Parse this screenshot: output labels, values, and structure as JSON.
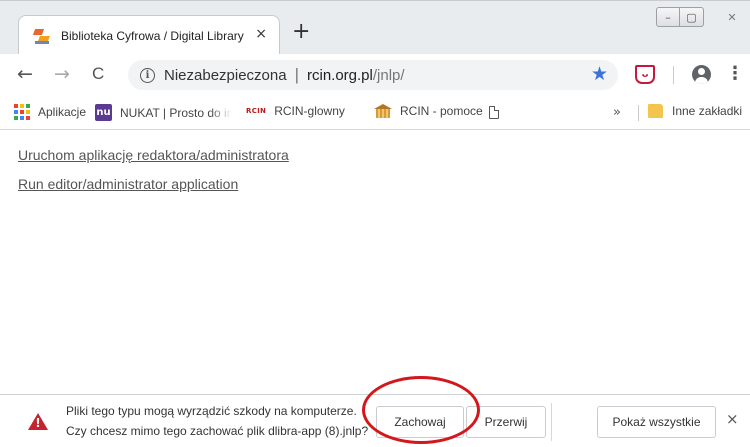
{
  "tab": {
    "title": "Biblioteka Cyfrowa / Digital Library",
    "close": "×"
  },
  "new_tab": "+",
  "window_controls": {
    "minimize": "–",
    "maximize": "▢",
    "close": "✕"
  },
  "toolbar": {
    "back": "←",
    "forward": "→",
    "reload": "C",
    "security_label": "Niezabezpieczona",
    "separator": "|",
    "url_host": "rcin.org.pl",
    "url_path": "/jnlp/",
    "bookmark_star": "★",
    "menu": "⋮"
  },
  "bookmarks": {
    "items": [
      {
        "label": "Aplikacje",
        "icon": "apps-grid-icon"
      },
      {
        "label": "NUKAT | Prosto do info",
        "icon": "nukat-icon"
      },
      {
        "label": "RCIN-glowny",
        "icon": "rcin-icon"
      },
      {
        "label": "RCIN - pomoce",
        "icon": "building-icon"
      },
      {
        "label": "",
        "icon": "page-icon"
      }
    ],
    "overflow": "»",
    "other_bookmarks": "Inne zakładki",
    "nu_logo_text": "nu",
    "rcin_logo_text": "RCIN"
  },
  "content": {
    "links": [
      "Uruchom aplikację redaktora/administratora",
      "Run editor/administrator application"
    ]
  },
  "download_bar": {
    "warning_line1": "Pliki tego typu mogą wyrządzić szkody na komputerze.",
    "warning_line2": "Czy chcesz mimo tego zachować plik dlibra-app (8).jnlp?",
    "keep_label": "Zachowaj",
    "discard_label": "Przerwij",
    "show_all_label": "Pokaż wszystkie",
    "close": "×",
    "warning_mark": "!"
  },
  "colors": {
    "accent_star": "#3b73d6",
    "warning_red": "#c6232e",
    "annotation_red": "#d3171d"
  }
}
